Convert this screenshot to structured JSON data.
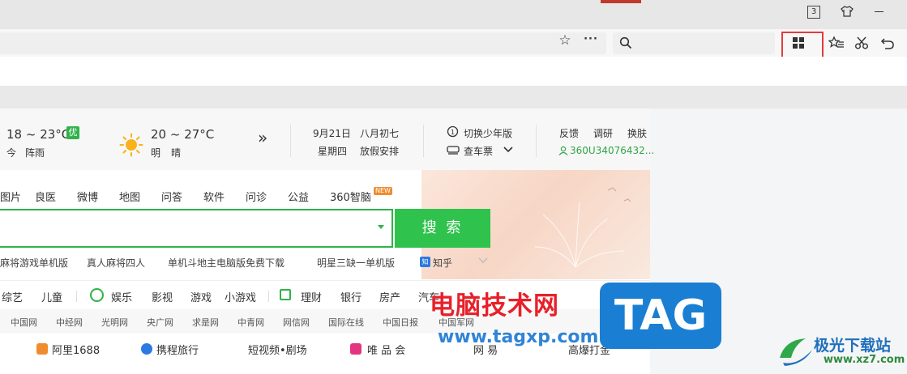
{
  "titlebar": {
    "window_count": "3"
  },
  "weather": {
    "today_temp": "18 ~ 23°C",
    "today_label": "今",
    "today_desc": "阵雨",
    "aqi": "优",
    "tomorrow_temp": "20 ~ 27°C",
    "tomorrow_label": "明",
    "tomorrow_desc": "晴",
    "more": "»"
  },
  "calendar": {
    "date": "9月21日",
    "lunar": "八月初七",
    "weekday": "星期四",
    "holiday": "放假安排"
  },
  "tools": {
    "youth": "切换少年版",
    "ticket": "查车票"
  },
  "user": {
    "feedback": "反馈",
    "survey": "调研",
    "skin": "换肤",
    "account": "360U34076432..."
  },
  "search_tabs": [
    "图片",
    "良医",
    "微博",
    "地图",
    "问答",
    "软件",
    "问诊",
    "公益",
    "360智脑"
  ],
  "new_badge": "NEW",
  "search_button": "搜 索",
  "hot": [
    "麻将游戏单机版",
    "真人麻将四人",
    "单机斗地主电脑版免费下载",
    "明星三缺一单机版",
    "知乎"
  ],
  "zhihu_icon_letter": "知",
  "categories": [
    "综艺",
    "儿童",
    "娱乐",
    "影视",
    "游戏",
    "小游戏",
    "理财",
    "银行",
    "房产",
    "汽车"
  ],
  "sites": [
    "中国网",
    "中经网",
    "光明网",
    "央广网",
    "求是网",
    "中青网",
    "网信网",
    "国际在线",
    "中国日报",
    "中国军网"
  ],
  "links": [
    "阿里1688",
    "携程旅行",
    "短视频•剧场",
    "唯 品 会",
    "网 易",
    "高爆打金"
  ],
  "watermark": {
    "cn": "电脑技术网",
    "url": "www.tagxp.com",
    "tag": "TAG",
    "site2_cn": "极光下载站",
    "site2_url": "www.xz7.com"
  },
  "colors": {
    "accent_green": "#2fb34a",
    "highlight_red": "#e23b3b",
    "tag_blue": "#1a7fd2"
  }
}
